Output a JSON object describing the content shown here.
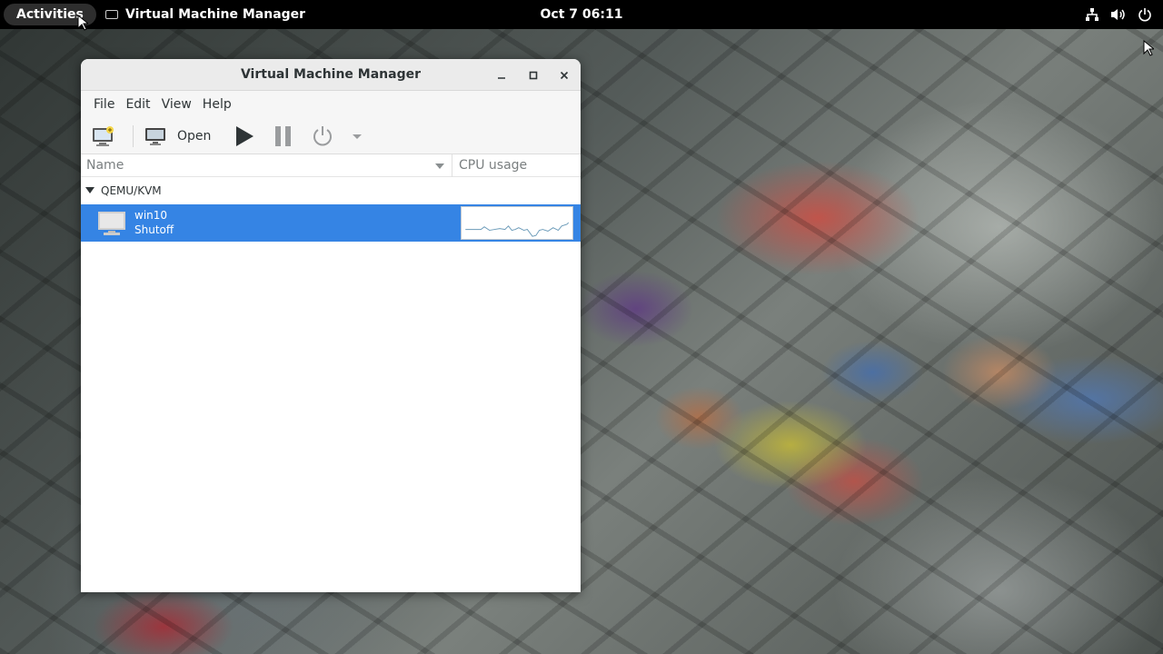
{
  "topbar": {
    "activities": "Activities",
    "app_name": "Virtual Machine Manager",
    "clock": "Oct 7  06:11",
    "tray_icons": [
      "network-icon",
      "volume-icon",
      "power-icon"
    ]
  },
  "window": {
    "title": "Virtual Machine Manager",
    "menus": [
      "File",
      "Edit",
      "View",
      "Help"
    ],
    "toolbar": {
      "new_vm_icon": "new-vm-icon",
      "open_label": "Open",
      "run_icon": "play-icon",
      "pause_icon": "pause-icon",
      "shutdown_icon": "power-icon",
      "dropdown_icon": "chevron-down-icon"
    },
    "columns": {
      "name": "Name",
      "cpu": "CPU usage"
    },
    "group": {
      "label": "QEMU/KVM"
    },
    "vms": [
      {
        "name": "win10",
        "status": "Shutoff"
      }
    ]
  },
  "colors": {
    "selection": "#3584e4",
    "topbar": "#000000",
    "titlebar": "#ebebeb",
    "graph_line": "#6a9ab8"
  }
}
